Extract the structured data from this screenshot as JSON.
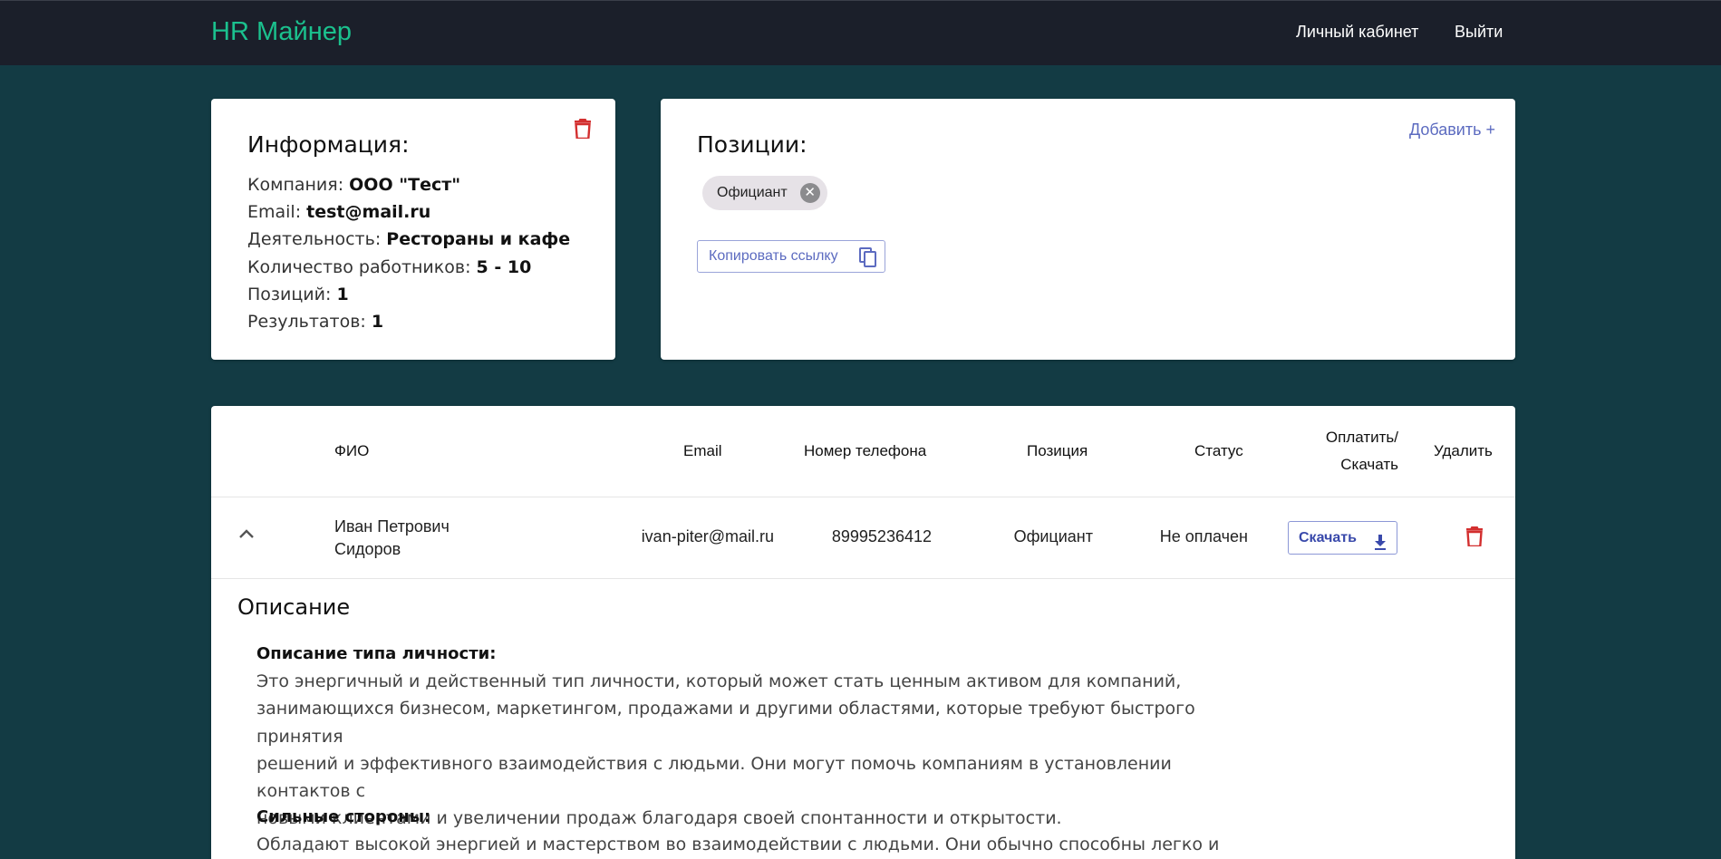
{
  "header": {
    "brand": "HR Майнер",
    "nav_cabinet": "Личный кабинет",
    "nav_logout": "Выйти"
  },
  "info": {
    "title": "Информация:",
    "company_label": "Компания: ",
    "company_value": "ООО \"Тест\"",
    "email_label": "Email: ",
    "email_value": "test@mail.ru",
    "activity_label": "Деятельность: ",
    "activity_value": "Рестораны и кафе",
    "workers_label": "Количество работников: ",
    "workers_value": "5 - 10",
    "positions_label": "Позиций: ",
    "positions_value": "1",
    "results_label": "Результатов: ",
    "results_value": "1"
  },
  "positions": {
    "title": "Позиции:",
    "add_label": "Добавить +",
    "chip_label": "Официант",
    "copy_label": "Копировать ссылку"
  },
  "table": {
    "headers": {
      "name": "ФИО",
      "email": "Email",
      "phone": "Номер телефона",
      "position": "Позиция",
      "status": "Статус",
      "pay_line1": "Оплатить/",
      "pay_line2": "Скачать",
      "delete": "Удалить"
    },
    "rows": [
      {
        "name_line1": "Иван Петрович",
        "name_line2": "Сидоров",
        "email": "ivan-piter@mail.ru",
        "phone": "89995236412",
        "position": "Официант",
        "status": "Не оплачен",
        "action_label": "Скачать"
      }
    ]
  },
  "description": {
    "title": "Описание",
    "sections": [
      {
        "heading": "Описание типа личности:",
        "lines": [
          "Это энергичный и действенный тип личности, который может стать ценным активом для компаний,",
          "занимающихся бизнесом, маркетингом, продажами и другими областями, которые требуют быстрого принятия",
          "решений и эффективного взаимодействия с людьми. Они могут помочь компаниям в установлении контактов с",
          "новыми клиентами и увеличении продаж благодаря своей спонтанности и открытости."
        ]
      },
      {
        "heading": "Сильные стороны:",
        "lines": [
          "Обладают высокой энергией и мастерством во взаимодействии с людьми. Они обычно способны легко и"
        ]
      }
    ]
  },
  "colors": {
    "background": "#133b44",
    "header": "#1b1f2a",
    "brand": "#1bc18e",
    "accent": "#5c6bc0",
    "danger": "#d32f2f"
  },
  "icons": {
    "delete": "trash-icon",
    "remove_chip": "close-circle-icon",
    "copy": "copy-icon",
    "expand": "chevron-up-icon",
    "download": "download-icon"
  }
}
